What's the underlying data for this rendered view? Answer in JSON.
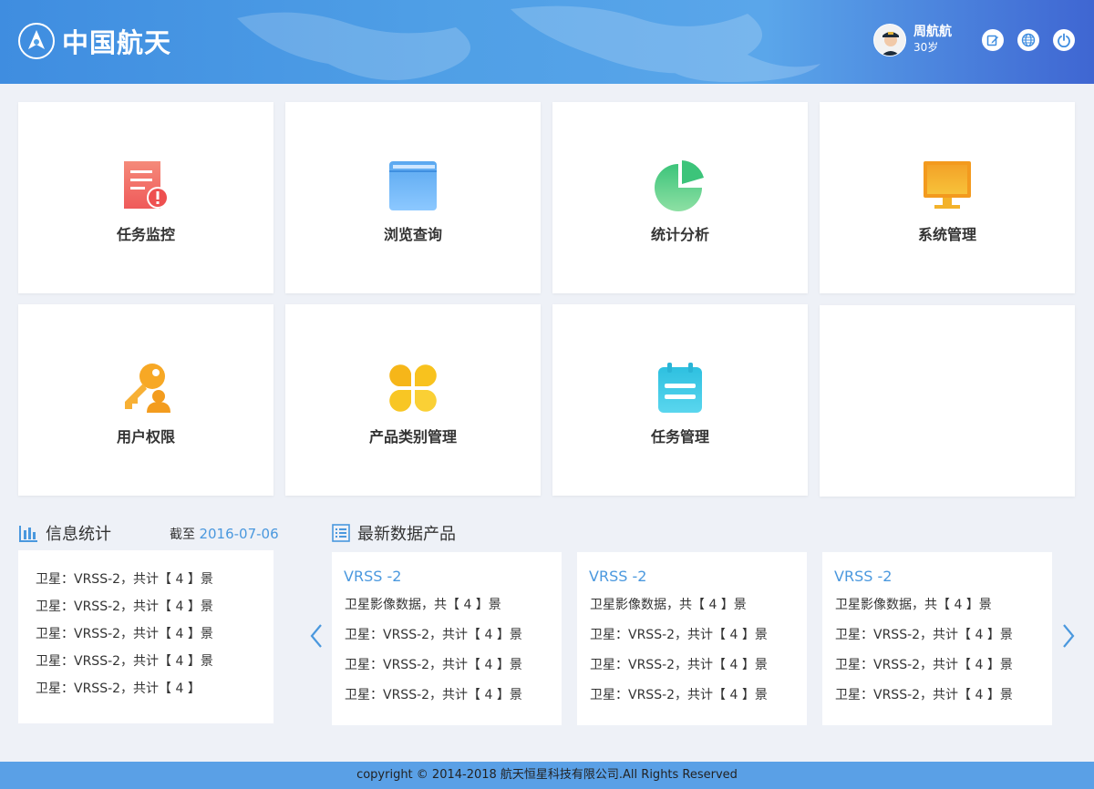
{
  "brand": {
    "name": "中国航天"
  },
  "user": {
    "name": "周航航",
    "age": "30岁"
  },
  "header_buttons": [
    "edit-icon",
    "globe-icon",
    "power-icon"
  ],
  "tiles": [
    {
      "label": "任务监控",
      "icon": "task-monitor-icon"
    },
    {
      "label": "浏览查询",
      "icon": "book-icon"
    },
    {
      "label": "统计分析",
      "icon": "pie-chart-icon"
    },
    {
      "label": "系统管理",
      "icon": "monitor-icon"
    },
    {
      "label": "用户权限",
      "icon": "key-user-icon"
    },
    {
      "label": "产品类别管理",
      "icon": "clover-icon"
    },
    {
      "label": "任务管理",
      "icon": "notepad-icon"
    }
  ],
  "info": {
    "title": "信息统计",
    "as_of_label": "截至",
    "as_of_date": "2016-07-06",
    "rows": [
      "卫星：VRSS-2，共计【 4 】景",
      "卫星：VRSS-2，共计【 4 】景",
      "卫星：VRSS-2，共计【 4 】景",
      "卫星：VRSS-2，共计【 4 】景",
      "卫星：VRSS-2，共计【 4 】"
    ]
  },
  "products": {
    "title": "最新数据产品",
    "cards": [
      {
        "title": "VRSS -2",
        "rows": [
          "卫星影像数据，共【 4 】景",
          "卫星：VRSS-2，共计【 4 】景",
          "卫星：VRSS-2，共计【 4 】景",
          "卫星：VRSS-2，共计【 4 】景"
        ]
      },
      {
        "title": "VRSS -2",
        "rows": [
          "卫星影像数据，共【 4 】景",
          "卫星：VRSS-2，共计【 4 】景",
          "卫星：VRSS-2，共计【 4 】景",
          "卫星：VRSS-2，共计【 4 】景"
        ]
      },
      {
        "title": "VRSS -2",
        "rows": [
          "卫星影像数据，共【 4 】景",
          "卫星：VRSS-2，共计【 4 】景",
          "卫星：VRSS-2，共计【 4 】景",
          "卫星：VRSS-2，共计【 4 】景"
        ]
      }
    ]
  },
  "footer": {
    "text": "copyright © 2014-2018 航天恒星科技有限公司.All Rights Reserved"
  },
  "colors": {
    "header": "#4f9fe6",
    "accent": "#4a98de",
    "footer": "#5aa0e6",
    "background": "#eef1f7"
  }
}
